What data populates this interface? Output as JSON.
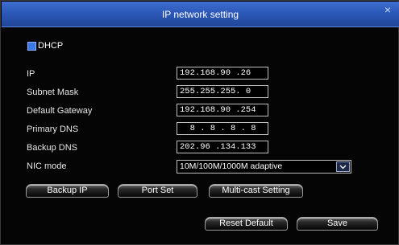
{
  "dialog": {
    "title": "IP network setting",
    "close_glyph": "×"
  },
  "dhcp": {
    "label": "DHCP",
    "checked": true
  },
  "fields": [
    {
      "label": "IP",
      "value": "192.168.90 .26"
    },
    {
      "label": "Subnet Mask",
      "value": "255.255.255. 0"
    },
    {
      "label": "Default Gateway",
      "value": "192.168.90 .254"
    },
    {
      "label": "Primary DNS",
      "value": "  8 . 8 . 8 . 8"
    },
    {
      "label": "Backup DNS",
      "value": "202.96 .134.133"
    }
  ],
  "nic": {
    "label": "NIC mode",
    "value": "10M/100M/1000M adaptive"
  },
  "buttons": {
    "backup_ip": "Backup IP",
    "port_set": "Port Set",
    "multicast": "Multi-cast Setting",
    "reset_default": "Reset Default",
    "save": "Save"
  },
  "colors": {
    "titlebar": "#2c58b8",
    "checkbox": "#3a78e6",
    "background": "#050505"
  },
  "icons": {
    "close": "close-icon",
    "dropdown": "chevron-down-icon"
  }
}
